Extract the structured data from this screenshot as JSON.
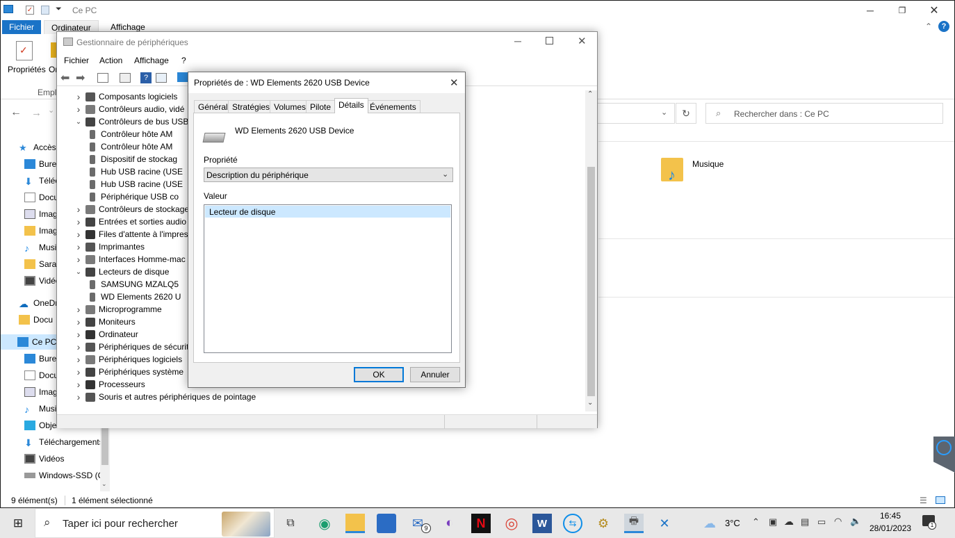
{
  "explorer": {
    "title": "Ce PC",
    "tabs": [
      "Fichier",
      "Ordinateur",
      "Affichage"
    ],
    "ribbon": {
      "properties_label": "Propriétés",
      "cut_label": "Or",
      "group_label": "Empla"
    },
    "search_placeholder": "Rechercher dans : Ce PC",
    "content_item": "Musique",
    "sidebar": [
      {
        "label": "Accès"
      },
      {
        "label": "Burea"
      },
      {
        "label": "Téléc"
      },
      {
        "label": "Docu"
      },
      {
        "label": "Imag"
      },
      {
        "label": "Imag"
      },
      {
        "label": "Musi"
      },
      {
        "label": "Sarah"
      },
      {
        "label": "Vidéo"
      },
      {
        "label": "OneDr"
      },
      {
        "label": "Docu"
      },
      {
        "label": "Ce PC"
      },
      {
        "label": "Burea"
      },
      {
        "label": "Docu"
      },
      {
        "label": "Imag"
      },
      {
        "label": "Musi"
      },
      {
        "label": "Obje"
      },
      {
        "label": "Téléchargements"
      },
      {
        "label": "Vidéos"
      },
      {
        "label": "Windows-SSD (C"
      }
    ],
    "status": {
      "count": "9 élément(s)",
      "selected": "1 élément sélectionné"
    }
  },
  "devmgr": {
    "title": "Gestionnaire de périphériques",
    "menu": [
      "Fichier",
      "Action",
      "Affichage",
      "?"
    ],
    "tree": [
      {
        "label": "Composants logiciels",
        "level": 0,
        "state": "collapsed"
      },
      {
        "label": "Contrôleurs audio, vidé",
        "level": 0,
        "state": "collapsed"
      },
      {
        "label": "Contrôleurs de bus USB",
        "level": 0,
        "state": "expanded"
      },
      {
        "label": "Contrôleur hôte AM",
        "level": 1,
        "state": "leaf"
      },
      {
        "label": "Contrôleur hôte AM",
        "level": 1,
        "state": "leaf"
      },
      {
        "label": "Dispositif de stockag",
        "level": 1,
        "state": "leaf"
      },
      {
        "label": "Hub USB racine (USE",
        "level": 1,
        "state": "leaf"
      },
      {
        "label": "Hub USB racine (USE",
        "level": 1,
        "state": "leaf"
      },
      {
        "label": "Périphérique USB co",
        "level": 1,
        "state": "leaf"
      },
      {
        "label": "Contrôleurs de stockage",
        "level": 0,
        "state": "collapsed"
      },
      {
        "label": "Entrées et sorties audio",
        "level": 0,
        "state": "collapsed"
      },
      {
        "label": "Files d'attente à l'impres",
        "level": 0,
        "state": "collapsed"
      },
      {
        "label": "Imprimantes",
        "level": 0,
        "state": "collapsed"
      },
      {
        "label": "Interfaces Homme-mac",
        "level": 0,
        "state": "collapsed"
      },
      {
        "label": "Lecteurs de disque",
        "level": 0,
        "state": "expanded"
      },
      {
        "label": "SAMSUNG MZALQ5",
        "level": 1,
        "state": "leaf"
      },
      {
        "label": "WD Elements 2620 U",
        "level": 1,
        "state": "leaf"
      },
      {
        "label": "Microprogramme",
        "level": 0,
        "state": "collapsed"
      },
      {
        "label": "Moniteurs",
        "level": 0,
        "state": "collapsed"
      },
      {
        "label": "Ordinateur",
        "level": 0,
        "state": "collapsed"
      },
      {
        "label": "Périphériques de sécurit",
        "level": 0,
        "state": "collapsed"
      },
      {
        "label": "Périphériques logiciels",
        "level": 0,
        "state": "collapsed"
      },
      {
        "label": "Périphériques système",
        "level": 0,
        "state": "collapsed"
      },
      {
        "label": "Processeurs",
        "level": 0,
        "state": "collapsed"
      },
      {
        "label": "Souris et autres périphériques de pointage",
        "level": 0,
        "state": "collapsed"
      }
    ]
  },
  "props": {
    "title": "Propriétés de : WD Elements 2620 USB Device",
    "tabs": [
      "Général",
      "Stratégies",
      "Volumes",
      "Pilote",
      "Détails",
      "Événements"
    ],
    "active_tab": "Détails",
    "device_name": "WD Elements 2620 USB Device",
    "property_label": "Propriété",
    "property_value": "Description du périphérique",
    "value_label": "Valeur",
    "value_item": "Lecteur de disque",
    "ok": "OK",
    "cancel": "Annuler"
  },
  "taskbar": {
    "search_placeholder": "Taper ici pour rechercher",
    "weather": "3°C",
    "time": "16:45",
    "date": "28/01/2023",
    "mail_badge": "9",
    "notif_badge": "1"
  }
}
